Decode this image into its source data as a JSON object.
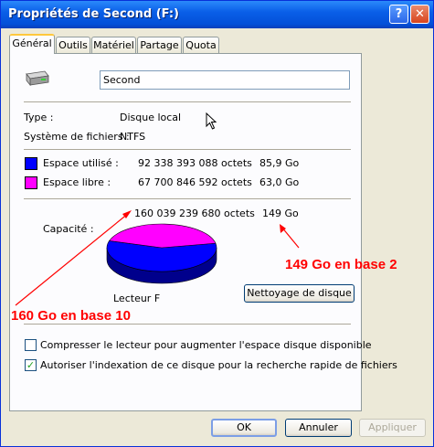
{
  "window": {
    "title": "Propriétés de Second (F:)",
    "help_label": "?",
    "close_label": "✕"
  },
  "tabs": [
    {
      "label": "Général",
      "active": true
    },
    {
      "label": "Outils"
    },
    {
      "label": "Matériel"
    },
    {
      "label": "Partage"
    },
    {
      "label": "Quota"
    }
  ],
  "drive": {
    "icon": "drive-icon",
    "name_value": "Second",
    "type_label": "Type :",
    "type_value": "Disque local",
    "fs_label": "Système de fichiers :",
    "fs_value": "NTFS"
  },
  "space": {
    "used": {
      "label": "Espace utilisé :",
      "bytes": "92 338 393 088 octets",
      "size": "85,9 Go",
      "color": "#0000ff"
    },
    "free": {
      "label": "Espace libre :",
      "bytes": "67 700 846 592 octets",
      "size": "63,0 Go",
      "color": "#ff00ff"
    },
    "capacity": {
      "label": "Capacité :",
      "bytes": "160 039 239 680 octets",
      "size": "149 Go"
    }
  },
  "chart_data": {
    "type": "pie",
    "categories": [
      "Espace utilisé",
      "Espace libre"
    ],
    "values": [
      85.9,
      63.0
    ],
    "colors": [
      "#0000ff",
      "#ff00ff"
    ]
  },
  "drive_label": "Lecteur F",
  "cleanup_button": "Nettoyage de disque",
  "options": {
    "compress": {
      "label": "Compresser le lecteur pour augmenter l'espace disque disponible",
      "checked": false
    },
    "index": {
      "label": "Autoriser l'indexation de ce disque pour la recherche rapide de fichiers",
      "checked": true
    }
  },
  "footer": {
    "ok": "OK",
    "cancel": "Annuler",
    "apply": "Appliquer"
  },
  "annotations": {
    "base2": "149 Go en base 2",
    "base10": "160 Go en base 10",
    "color": "#ff0000"
  }
}
